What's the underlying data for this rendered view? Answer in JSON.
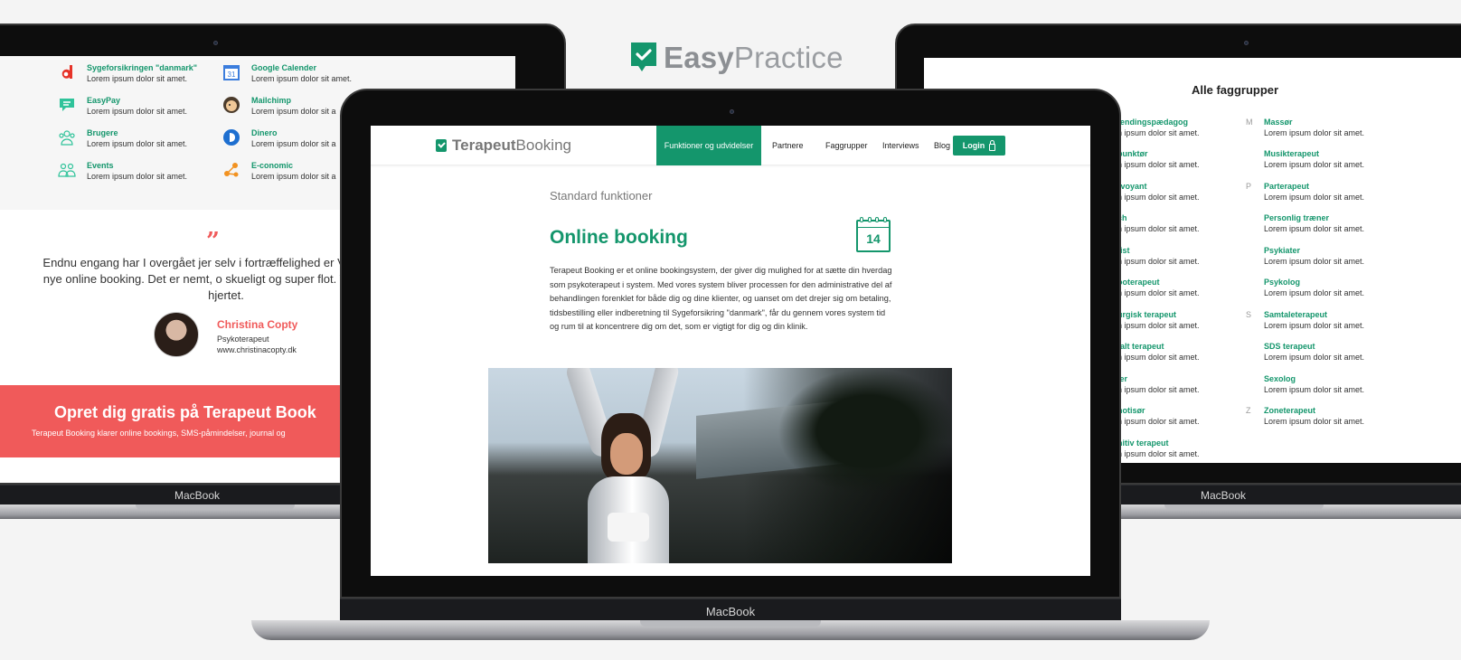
{
  "brand": {
    "bold": "Easy",
    "light": "Practice",
    "accent": "#14966c"
  },
  "device_label": "MacBook",
  "left_screen": {
    "integrations": [
      {
        "icon": "danmark-icon",
        "title": "Sygeforsikringen \"danmark\"",
        "desc": "Lorem ipsum dolor sit amet."
      },
      {
        "icon": "calendar-31-icon",
        "title": "Google Calender",
        "desc": "Lorem ipsum dolor sit amet."
      },
      {
        "icon": "easypay-icon",
        "title": "EasyPay",
        "desc": "Lorem ipsum dolor sit amet."
      },
      {
        "icon": "mailchimp-icon",
        "title": "Mailchimp",
        "desc": "Lorem ipsum dolor sit a"
      },
      {
        "icon": "users-icon",
        "title": "Brugere",
        "desc": "Lorem ipsum dolor sit amet."
      },
      {
        "icon": "dinero-icon",
        "title": "Dinero",
        "desc": "Lorem ipsum dolor sit a"
      },
      {
        "icon": "events-icon",
        "title": "Events",
        "desc": "Lorem ipsum dolor sit amet."
      },
      {
        "icon": "economic-icon",
        "title": "E-conomic",
        "desc": "Lorem ipsum dolor sit a"
      }
    ],
    "quote_mark": "”",
    "quote": "Endnu engang har I overgået jer selv i fortræffelighed er VILD med det nye online booking. Det er nemt, o skueligt og super flot. Tak tak tak af hjertet.",
    "author_name": "Christina Copty",
    "author_role": "Psykoterapeut",
    "author_url": "www.christinacopty.dk",
    "cta_title": "Opret dig gratis på Terapeut Book",
    "cta_sub": "Terapeut Booking klarer online bookings, SMS-påmindelser, journal og"
  },
  "center_screen": {
    "logo_bold": "Terapeut",
    "logo_light": "Booking",
    "nav": {
      "active": "Funktioner og udvidelser",
      "items": [
        "Partnere",
        "Faggrupper",
        "Interviews",
        "Blog"
      ],
      "login": "Login"
    },
    "kicker": "Standard funktioner",
    "heading": "Online booking",
    "calendar_day": "14",
    "body": "Terapeut Booking er et online bookingsystem, der giver dig mulighed for at sætte din hverdag som psykoterapeut i system. Med vores system bliver processen for den administrative del af behandlingen forenklet for både dig og dine klienter, og uanset om det drejer sig om betaling, tidsbestilling eller indberetning til Sygeforsikring \"danmark\", får du gennem vores system tid og rum til at koncentrere dig om det, som er vigtigt for dig og din klinik."
  },
  "right_screen": {
    "title": "Alle faggrupper",
    "left_col": [
      {
        "letter": "",
        "name": "ændingspædagog",
        "desc": "n ipsum dolor sit amet."
      },
      {
        "letter": "",
        "name": "punktør",
        "desc": "n ipsum dolor sit amet."
      },
      {
        "letter": "",
        "name": "rvoyant",
        "desc": "n ipsum dolor sit amet."
      },
      {
        "letter": "",
        "name": "ch",
        "desc": "n ipsum dolor sit amet."
      },
      {
        "letter": "",
        "name": "tist",
        "desc": "n ipsum dolor sit amet."
      },
      {
        "letter": "",
        "name": "ooterapeut",
        "desc": "n ipsum dolor sit amet."
      },
      {
        "letter": "",
        "name": "urgisk terapeut",
        "desc": "n ipsum dolor sit amet."
      },
      {
        "letter": "",
        "name": "talt terapeut",
        "desc": "n ipsum dolor sit amet."
      },
      {
        "letter": "",
        "name": "ler",
        "desc": "n ipsum dolor sit amet."
      },
      {
        "letter": "",
        "name": "notisør",
        "desc": "n ipsum dolor sit amet."
      },
      {
        "letter": "",
        "name": "nitiv terapeut",
        "desc": "n ipsum dolor sit amet."
      }
    ],
    "right_col": [
      {
        "letter": "M",
        "name": "Massør",
        "desc": "Lorem ipsum dolor sit amet."
      },
      {
        "letter": "",
        "name": "Musikterapeut",
        "desc": "Lorem ipsum dolor sit amet."
      },
      {
        "letter": "P",
        "name": "Parterapeut",
        "desc": "Lorem ipsum dolor sit amet."
      },
      {
        "letter": "",
        "name": "Personlig træner",
        "desc": "Lorem ipsum dolor sit amet."
      },
      {
        "letter": "",
        "name": "Psykiater",
        "desc": "Lorem ipsum dolor sit amet."
      },
      {
        "letter": "",
        "name": "Psykolog",
        "desc": "Lorem ipsum dolor sit amet."
      },
      {
        "letter": "S",
        "name": "Samtaleterapeut",
        "desc": "Lorem ipsum dolor sit amet."
      },
      {
        "letter": "",
        "name": "SDS terapeut",
        "desc": "Lorem ipsum dolor sit amet."
      },
      {
        "letter": "",
        "name": "Sexolog",
        "desc": "Lorem ipsum dolor sit amet."
      },
      {
        "letter": "Z",
        "name": "Zoneterapeut",
        "desc": "Lorem ipsum dolor sit amet."
      }
    ]
  }
}
